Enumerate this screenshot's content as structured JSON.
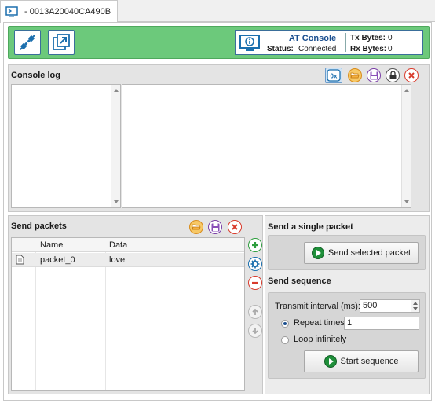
{
  "tab": {
    "title": "- 0013A20040CA490B"
  },
  "toolbar": {
    "status": {
      "console_name": "AT Console",
      "status_label": "Status:",
      "status_value": "Connected",
      "tx_label": "Tx Bytes:",
      "tx_value": "0",
      "rx_label": "Rx Bytes:",
      "rx_value": "0"
    }
  },
  "console_log": {
    "title": "Console log",
    "hex_toggle_label": "0x"
  },
  "send_packets": {
    "title": "Send packets",
    "columns": [
      "Name",
      "Data"
    ],
    "rows": [
      {
        "name": "packet_0",
        "data": "love"
      }
    ]
  },
  "single_packet": {
    "title": "Send a single packet",
    "button_label": "Send selected packet"
  },
  "sequence": {
    "title": "Send sequence",
    "interval_label": "Transmit interval (ms):",
    "interval_value": "500",
    "repeat_label": "Repeat times",
    "repeat_value": "1",
    "loop_label": "Loop infinitely",
    "start_label": "Start sequence",
    "mode": "repeat"
  },
  "colors": {
    "toolbar_green": "#6cc97b",
    "accent_blue": "#1b4f8f",
    "add_green": "#2e9e3e",
    "remove_red": "#d93a2b",
    "load_orange": "#f0a030",
    "save_purple": "#7a3fa6"
  }
}
